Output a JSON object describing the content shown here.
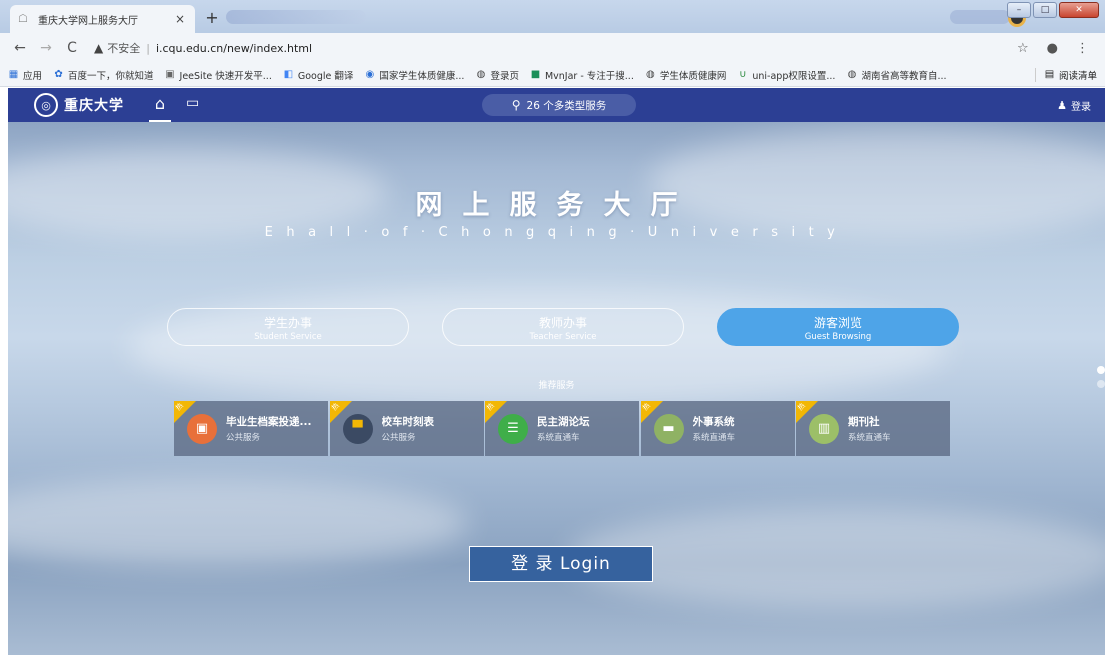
{
  "browser": {
    "tab_title": "重庆大学网上服务大厅",
    "tab_close": "×",
    "new_tab": "+",
    "insecure_label": "不安全",
    "url": "i.cqu.edu.cn/new/index.html",
    "bookmarks": [
      {
        "label": "应用",
        "icon": "apps-grid-icon",
        "color": "#2b6fd6"
      },
      {
        "label": "百度一下，你就知道",
        "icon": "baidu-paw-icon",
        "color": "#2b6fd6"
      },
      {
        "label": "JeeSite 快速开发平...",
        "icon": "jeesite-icon",
        "color": "#666666"
      },
      {
        "label": "Google 翻译",
        "icon": "google-translate-icon",
        "color": "#4285f4"
      },
      {
        "label": "国家学生体质健康...",
        "icon": "globe-icon",
        "color": "#2b6fd6"
      },
      {
        "label": "登录页",
        "icon": "globe-icon",
        "color": "#444444"
      },
      {
        "label": "MvnJar - 专注于搜...",
        "icon": "mvnjar-icon",
        "color": "#1b8f5a"
      },
      {
        "label": "学生体质健康网",
        "icon": "globe-icon",
        "color": "#444444"
      },
      {
        "label": "uni-app权限设置...",
        "icon": "uniapp-icon",
        "color": "#2b8a3e"
      },
      {
        "label": "湖南省高等教育自...",
        "icon": "globe-icon",
        "color": "#444444"
      }
    ],
    "reading_list": "阅读清单"
  },
  "site": {
    "search_label": "26 个多类型服务",
    "login_link": "登录",
    "hero_title": "网上服务大厅",
    "hero_subtitle": "Ehall·of·Chongqing·University",
    "roles": [
      {
        "cn": "学生办事",
        "en": "Student Service",
        "active": false
      },
      {
        "cn": "教师办事",
        "en": "Teacher Service",
        "active": false
      },
      {
        "cn": "游客浏览",
        "en": "Guest Browsing",
        "active": true
      }
    ],
    "recommend_label": "推荐服务",
    "hot_badge": "热",
    "cards": [
      {
        "title": "毕业生档案投递...",
        "sub": "公共服务",
        "icon": "file-icon",
        "color": "#e8703a"
      },
      {
        "title": "校车时刻表",
        "sub": "公共服务",
        "icon": "bus-icon",
        "color": "#3b4a63"
      },
      {
        "title": "民主湖论坛",
        "sub": "系统直通车",
        "icon": "forum-icon",
        "color": "#3fae49"
      },
      {
        "title": "外事系统",
        "sub": "系统直通车",
        "icon": "briefcase-icon",
        "color": "#8fb264"
      },
      {
        "title": "期刊社",
        "sub": "系统直通车",
        "icon": "journal-icon",
        "color": "#9cbf68"
      }
    ],
    "login_button": "登 录 Login"
  }
}
